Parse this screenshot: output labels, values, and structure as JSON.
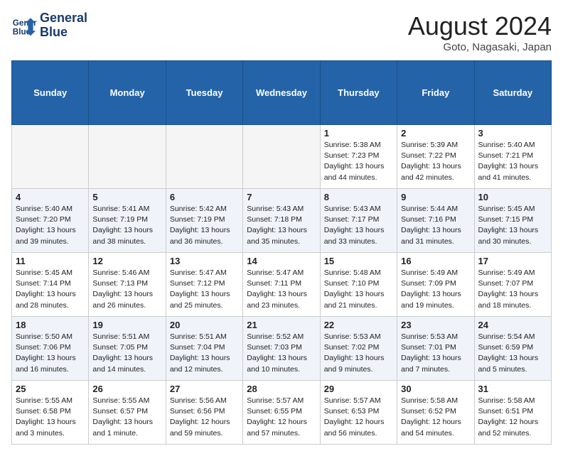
{
  "header": {
    "logo_line1": "General",
    "logo_line2": "Blue",
    "month": "August 2024",
    "location": "Goto, Nagasaki, Japan"
  },
  "days_of_week": [
    "Sunday",
    "Monday",
    "Tuesday",
    "Wednesday",
    "Thursday",
    "Friday",
    "Saturday"
  ],
  "weeks": [
    [
      {
        "day": "",
        "info": ""
      },
      {
        "day": "",
        "info": ""
      },
      {
        "day": "",
        "info": ""
      },
      {
        "day": "",
        "info": ""
      },
      {
        "day": "1",
        "info": "Sunrise: 5:38 AM\nSunset: 7:23 PM\nDaylight: 13 hours\nand 44 minutes."
      },
      {
        "day": "2",
        "info": "Sunrise: 5:39 AM\nSunset: 7:22 PM\nDaylight: 13 hours\nand 42 minutes."
      },
      {
        "day": "3",
        "info": "Sunrise: 5:40 AM\nSunset: 7:21 PM\nDaylight: 13 hours\nand 41 minutes."
      }
    ],
    [
      {
        "day": "4",
        "info": "Sunrise: 5:40 AM\nSunset: 7:20 PM\nDaylight: 13 hours\nand 39 minutes."
      },
      {
        "day": "5",
        "info": "Sunrise: 5:41 AM\nSunset: 7:19 PM\nDaylight: 13 hours\nand 38 minutes."
      },
      {
        "day": "6",
        "info": "Sunrise: 5:42 AM\nSunset: 7:19 PM\nDaylight: 13 hours\nand 36 minutes."
      },
      {
        "day": "7",
        "info": "Sunrise: 5:43 AM\nSunset: 7:18 PM\nDaylight: 13 hours\nand 35 minutes."
      },
      {
        "day": "8",
        "info": "Sunrise: 5:43 AM\nSunset: 7:17 PM\nDaylight: 13 hours\nand 33 minutes."
      },
      {
        "day": "9",
        "info": "Sunrise: 5:44 AM\nSunset: 7:16 PM\nDaylight: 13 hours\nand 31 minutes."
      },
      {
        "day": "10",
        "info": "Sunrise: 5:45 AM\nSunset: 7:15 PM\nDaylight: 13 hours\nand 30 minutes."
      }
    ],
    [
      {
        "day": "11",
        "info": "Sunrise: 5:45 AM\nSunset: 7:14 PM\nDaylight: 13 hours\nand 28 minutes."
      },
      {
        "day": "12",
        "info": "Sunrise: 5:46 AM\nSunset: 7:13 PM\nDaylight: 13 hours\nand 26 minutes."
      },
      {
        "day": "13",
        "info": "Sunrise: 5:47 AM\nSunset: 7:12 PM\nDaylight: 13 hours\nand 25 minutes."
      },
      {
        "day": "14",
        "info": "Sunrise: 5:47 AM\nSunset: 7:11 PM\nDaylight: 13 hours\nand 23 minutes."
      },
      {
        "day": "15",
        "info": "Sunrise: 5:48 AM\nSunset: 7:10 PM\nDaylight: 13 hours\nand 21 minutes."
      },
      {
        "day": "16",
        "info": "Sunrise: 5:49 AM\nSunset: 7:09 PM\nDaylight: 13 hours\nand 19 minutes."
      },
      {
        "day": "17",
        "info": "Sunrise: 5:49 AM\nSunset: 7:07 PM\nDaylight: 13 hours\nand 18 minutes."
      }
    ],
    [
      {
        "day": "18",
        "info": "Sunrise: 5:50 AM\nSunset: 7:06 PM\nDaylight: 13 hours\nand 16 minutes."
      },
      {
        "day": "19",
        "info": "Sunrise: 5:51 AM\nSunset: 7:05 PM\nDaylight: 13 hours\nand 14 minutes."
      },
      {
        "day": "20",
        "info": "Sunrise: 5:51 AM\nSunset: 7:04 PM\nDaylight: 13 hours\nand 12 minutes."
      },
      {
        "day": "21",
        "info": "Sunrise: 5:52 AM\nSunset: 7:03 PM\nDaylight: 13 hours\nand 10 minutes."
      },
      {
        "day": "22",
        "info": "Sunrise: 5:53 AM\nSunset: 7:02 PM\nDaylight: 13 hours\nand 9 minutes."
      },
      {
        "day": "23",
        "info": "Sunrise: 5:53 AM\nSunset: 7:01 PM\nDaylight: 13 hours\nand 7 minutes."
      },
      {
        "day": "24",
        "info": "Sunrise: 5:54 AM\nSunset: 6:59 PM\nDaylight: 13 hours\nand 5 minutes."
      }
    ],
    [
      {
        "day": "25",
        "info": "Sunrise: 5:55 AM\nSunset: 6:58 PM\nDaylight: 13 hours\nand 3 minutes."
      },
      {
        "day": "26",
        "info": "Sunrise: 5:55 AM\nSunset: 6:57 PM\nDaylight: 13 hours\nand 1 minute."
      },
      {
        "day": "27",
        "info": "Sunrise: 5:56 AM\nSunset: 6:56 PM\nDaylight: 12 hours\nand 59 minutes."
      },
      {
        "day": "28",
        "info": "Sunrise: 5:57 AM\nSunset: 6:55 PM\nDaylight: 12 hours\nand 57 minutes."
      },
      {
        "day": "29",
        "info": "Sunrise: 5:57 AM\nSunset: 6:53 PM\nDaylight: 12 hours\nand 56 minutes."
      },
      {
        "day": "30",
        "info": "Sunrise: 5:58 AM\nSunset: 6:52 PM\nDaylight: 12 hours\nand 54 minutes."
      },
      {
        "day": "31",
        "info": "Sunrise: 5:58 AM\nSunset: 6:51 PM\nDaylight: 12 hours\nand 52 minutes."
      }
    ]
  ]
}
